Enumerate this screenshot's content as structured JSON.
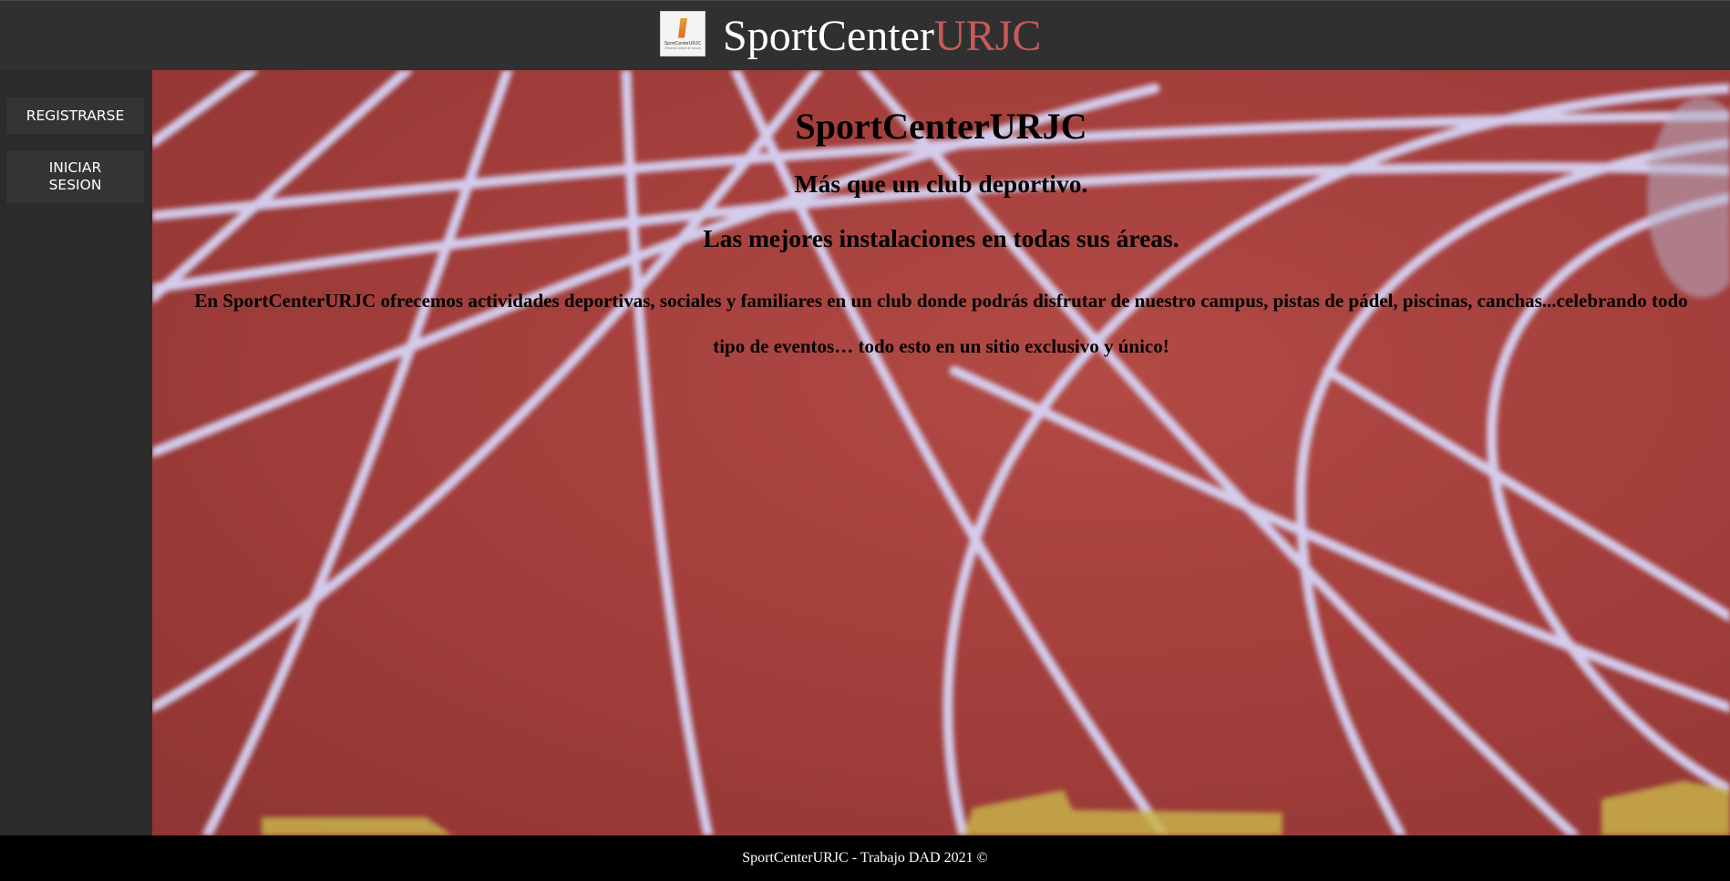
{
  "header": {
    "logo_text": "SportCenterURJC",
    "logo_subtext": "Reserva online de turnos",
    "title_part1": "SportCenter",
    "title_part2": "URJC"
  },
  "sidebar": {
    "items": [
      {
        "label": "REGISTRARSE"
      },
      {
        "label": "INICIAR SESION"
      }
    ]
  },
  "main": {
    "title": "SportCenterURJC",
    "subtitle1": "Más que un club deportivo.",
    "subtitle2": "Las mejores instalaciones en todas sus áreas.",
    "description": "En SportCenterURJC ofrecemos actividades deportivas, sociales y familiares en un club donde podrás disfrutar de nuestro campus, pistas de pádel, piscinas, canchas...celebrando todo tipo de eventos… todo esto en un sitio exclusivo y único!"
  },
  "footer": {
    "text": "SportCenterURJC - Trabajo DAD 2021 ©"
  },
  "colors": {
    "header_bg": "#303030",
    "sidebar_bg": "#2b2b2b",
    "brand_accent": "#c85a5a",
    "track_red": "#a43f3c",
    "footer_bg": "#000000"
  }
}
